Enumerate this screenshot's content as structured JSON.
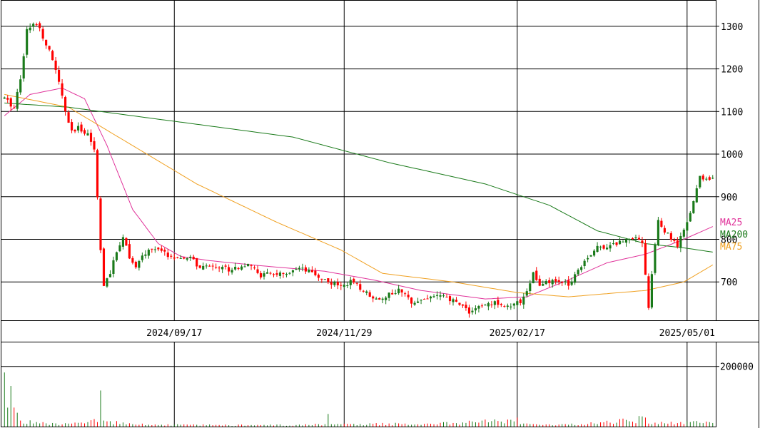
{
  "chart_data": [
    {
      "type": "candlestick",
      "price_axis": {
        "ylim": [
          610,
          1360
        ],
        "ticks": [
          700,
          800,
          900,
          1000,
          1100,
          1200,
          1300
        ],
        "tick_labels": [
          "700",
          "800",
          "900",
          "1000",
          "1100",
          "1200",
          "1300"
        ]
      },
      "x_labels": [
        "2024/09/17",
        "2024/11/29",
        "2025/02/17",
        "2025/05/01"
      ],
      "legend": [
        {
          "label": "MA25",
          "color": "#e0339a"
        },
        {
          "label": "MA200",
          "color": "#1a7a1a"
        },
        {
          "label": "MA75",
          "color": "#f0a020"
        }
      ],
      "colors": {
        "up": "#1a7a1a",
        "down": "#ff0000",
        "grid": "#000000"
      },
      "n_sessions": 222,
      "price_anchors": [
        [
          0,
          1130
        ],
        [
          3,
          1110
        ],
        [
          5,
          1180
        ],
        [
          7,
          1290
        ],
        [
          10,
          1310
        ],
        [
          13,
          1260
        ],
        [
          16,
          1200
        ],
        [
          19,
          1100
        ],
        [
          21,
          1050
        ],
        [
          23,
          1060
        ],
        [
          26,
          1050
        ],
        [
          28,
          1010
        ],
        [
          29,
          900
        ],
        [
          30,
          780
        ],
        [
          31,
          690
        ],
        [
          33,
          720
        ],
        [
          35,
          770
        ],
        [
          37,
          810
        ],
        [
          39,
          760
        ],
        [
          41,
          730
        ],
        [
          43,
          760
        ],
        [
          46,
          780
        ],
        [
          49,
          770
        ],
        [
          52,
          760
        ],
        [
          55,
          750
        ],
        [
          58,
          760
        ],
        [
          61,
          730
        ],
        [
          65,
          740
        ],
        [
          70,
          730
        ],
        [
          75,
          740
        ],
        [
          78,
          730
        ],
        [
          80,
          715
        ],
        [
          84,
          720
        ],
        [
          88,
          715
        ],
        [
          92,
          730
        ],
        [
          96,
          720
        ],
        [
          100,
          705
        ],
        [
          104,
          690
        ],
        [
          108,
          700
        ],
        [
          112,
          680
        ],
        [
          116,
          660
        ],
        [
          120,
          670
        ],
        [
          123,
          680
        ],
        [
          127,
          655
        ],
        [
          131,
          660
        ],
        [
          135,
          670
        ],
        [
          138,
          660
        ],
        [
          142,
          650
        ],
        [
          145,
          630
        ],
        [
          148,
          640
        ],
        [
          152,
          650
        ],
        [
          155,
          650
        ],
        [
          158,
          640
        ],
        [
          161,
          655
        ],
        [
          163,
          680
        ],
        [
          165,
          720
        ],
        [
          167,
          690
        ],
        [
          170,
          700
        ],
        [
          173,
          700
        ],
        [
          176,
          695
        ],
        [
          179,
          730
        ],
        [
          182,
          760
        ],
        [
          185,
          780
        ],
        [
          188,
          785
        ],
        [
          191,
          790
        ],
        [
          194,
          800
        ],
        [
          197,
          810
        ],
        [
          199,
          790
        ],
        [
          200,
          720
        ],
        [
          201,
          640
        ],
        [
          202,
          720
        ],
        [
          203,
          790
        ],
        [
          204,
          840
        ],
        [
          206,
          820
        ],
        [
          208,
          800
        ],
        [
          210,
          785
        ],
        [
          212,
          820
        ],
        [
          214,
          860
        ],
        [
          216,
          920
        ],
        [
          217,
          945
        ],
        [
          219,
          940
        ],
        [
          221,
          950
        ]
      ],
      "ma_anchors": {
        "MA25": [
          [
            0,
            1090
          ],
          [
            8,
            1140
          ],
          [
            18,
            1155
          ],
          [
            25,
            1130
          ],
          [
            32,
            1020
          ],
          [
            40,
            870
          ],
          [
            48,
            790
          ],
          [
            55,
            760
          ],
          [
            64,
            750
          ],
          [
            80,
            738
          ],
          [
            100,
            725
          ],
          [
            115,
            705
          ],
          [
            130,
            680
          ],
          [
            150,
            660
          ],
          [
            163,
            665
          ],
          [
            176,
            705
          ],
          [
            188,
            745
          ],
          [
            200,
            765
          ],
          [
            212,
            800
          ],
          [
            221,
            830
          ]
        ],
        "MA75": [
          [
            0,
            1140
          ],
          [
            20,
            1110
          ],
          [
            40,
            1020
          ],
          [
            60,
            930
          ],
          [
            85,
            840
          ],
          [
            105,
            775
          ],
          [
            118,
            720
          ],
          [
            140,
            700
          ],
          [
            160,
            675
          ],
          [
            176,
            665
          ],
          [
            200,
            680
          ],
          [
            212,
            700
          ],
          [
            221,
            740
          ]
        ],
        "MA200": [
          [
            0,
            1120
          ],
          [
            20,
            1110
          ],
          [
            60,
            1070
          ],
          [
            90,
            1040
          ],
          [
            120,
            980
          ],
          [
            150,
            930
          ],
          [
            170,
            880
          ],
          [
            185,
            820
          ],
          [
            200,
            790
          ],
          [
            212,
            780
          ],
          [
            221,
            770
          ]
        ]
      },
      "volume_axis": {
        "ticks": [
          200000
        ],
        "tick_labels": [
          "200000"
        ],
        "ymax": 280000
      },
      "volume_anchors": [
        [
          0,
          180000
        ],
        [
          5,
          20000
        ],
        [
          10,
          15000
        ],
        [
          15,
          12000
        ],
        [
          20,
          10000
        ],
        [
          28,
          25000
        ],
        [
          29,
          15000
        ],
        [
          30,
          120000
        ],
        [
          31,
          20000
        ],
        [
          40,
          8000
        ],
        [
          60,
          6000
        ],
        [
          80,
          5000
        ],
        [
          100,
          8000
        ],
        [
          101,
          42000
        ],
        [
          102,
          8000
        ],
        [
          140,
          12000
        ],
        [
          160,
          30000
        ],
        [
          161,
          8000
        ],
        [
          180,
          8000
        ],
        [
          200,
          30000
        ],
        [
          201,
          10000
        ],
        [
          215,
          18000
        ],
        [
          221,
          12000
        ]
      ]
    }
  ]
}
